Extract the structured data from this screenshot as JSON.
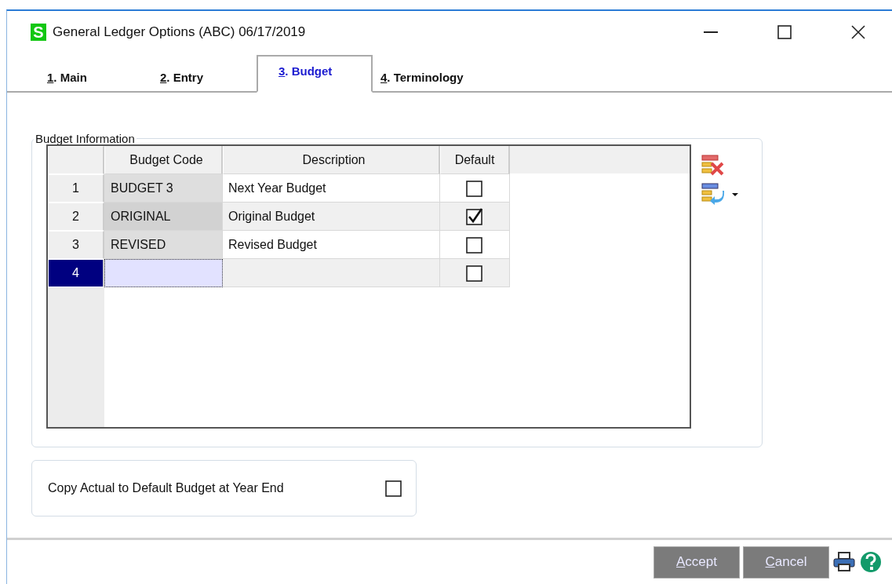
{
  "window": {
    "app_icon": "S",
    "title": "General Ledger Options (ABC) 06/17/2019"
  },
  "tabs": [
    {
      "hotkey": "1",
      "label": ". Main",
      "selected": false
    },
    {
      "hotkey": "2",
      "label": ". Entry",
      "selected": false
    },
    {
      "hotkey": "3",
      "label": ". Budget",
      "selected": true
    },
    {
      "hotkey": "4",
      "label": ". Terminology",
      "selected": false
    }
  ],
  "budget_information": {
    "title": "Budget Information",
    "columns": [
      "Budget Code",
      "Description",
      "Default"
    ],
    "rows": [
      {
        "number": "1",
        "code": "BUDGET 3",
        "description": "Next Year Budget",
        "default": false,
        "selected": false
      },
      {
        "number": "2",
        "code": "ORIGINAL",
        "description": "Original Budget",
        "default": true,
        "selected": false
      },
      {
        "number": "3",
        "code": "REVISED",
        "description": "Revised Budget",
        "default": false,
        "selected": false
      },
      {
        "number": "4",
        "code": "",
        "description": "",
        "default": false,
        "selected": true
      }
    ]
  },
  "copy_actual": {
    "label": "Copy Actual to Default Budget at Year End",
    "checked": false
  },
  "buttons": [
    {
      "hotkey": "A",
      "label": "ccept"
    },
    {
      "hotkey": "C",
      "label": "ancel"
    }
  ]
}
